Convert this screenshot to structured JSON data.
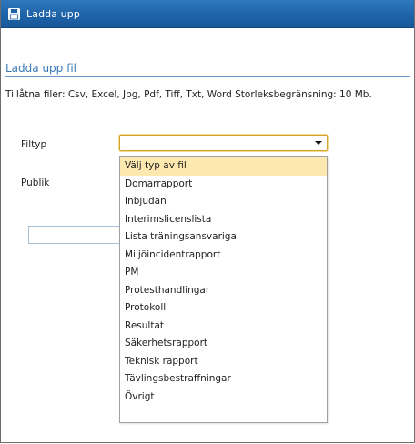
{
  "window": {
    "title": "Ladda upp",
    "title_icon": "save-floppy-icon"
  },
  "section": {
    "header": "Ladda upp fil",
    "allowed_files": "Tillåtna filer: Csv, Excel, Jpg, Pdf, Tiff, Txt, Word Storleksbegränsning: 10 Mb."
  },
  "form": {
    "filtyp_label": "Filtyp",
    "publik_label": "Publik",
    "filtyp_value": "",
    "text_input_value": ""
  },
  "dropdown": {
    "selected_index": 0,
    "options": [
      "Välj typ av fil",
      "Domarrapport",
      "Inbjudan",
      "Interimslicenslista",
      "Lista träningsansvariga",
      "Miljöincidentrapport",
      "PM",
      "Protesthandlingar",
      "Protokoll",
      "Resultat",
      "Säkerhetsrapport",
      "Teknisk rapport",
      "Tävlingsbestraffningar",
      "Övrigt"
    ]
  },
  "colors": {
    "titlebar": "#1e63a8",
    "header_text": "#3a78b6",
    "highlight": "#fde9b0",
    "select_border": "#d3a431"
  }
}
